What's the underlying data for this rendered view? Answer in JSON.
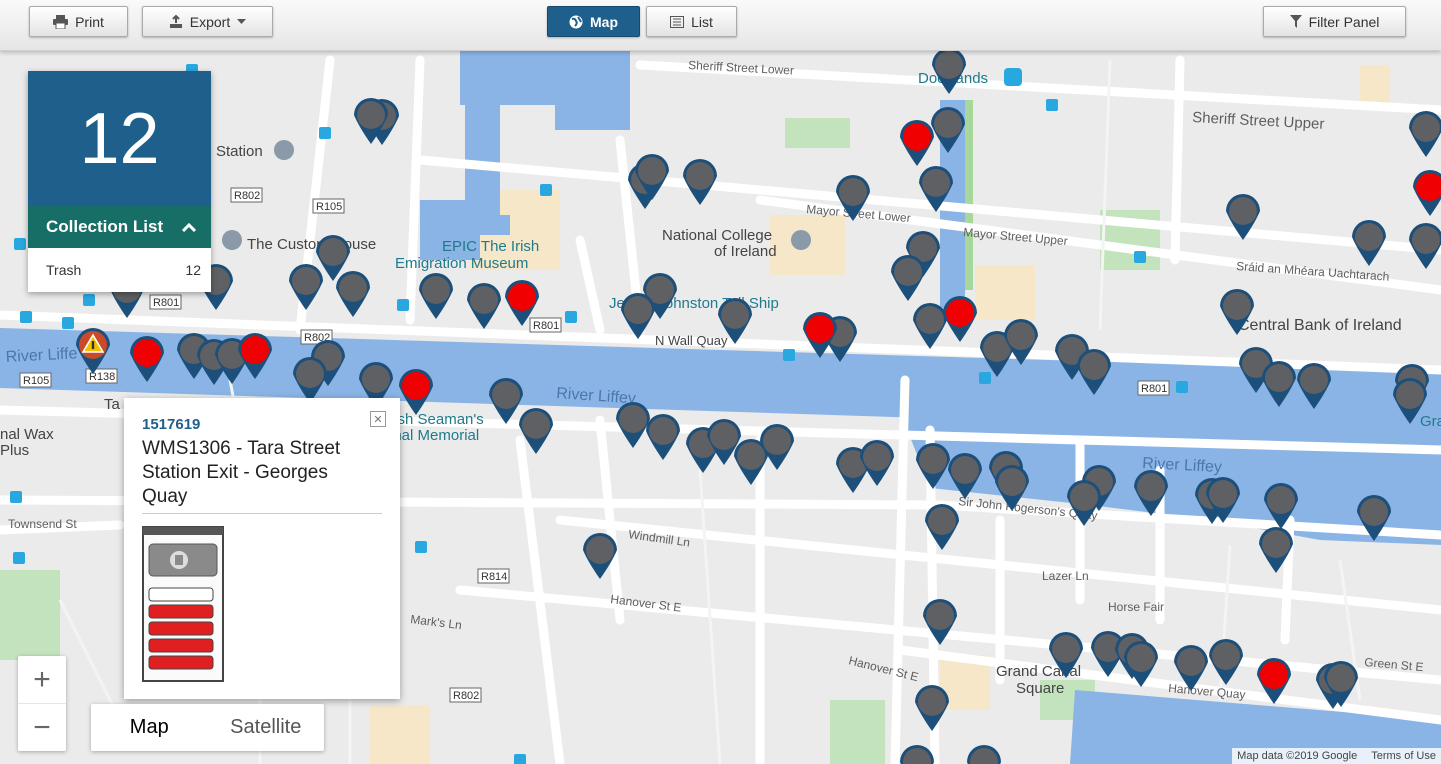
{
  "toolbar": {
    "print": "Print",
    "export": "Export",
    "map": "Map",
    "list": "List",
    "filter": "Filter Panel"
  },
  "counter": {
    "count": "12",
    "header": "Collection List",
    "items": [
      {
        "label": "Trash",
        "count": "12"
      }
    ]
  },
  "popup": {
    "id": "1517619",
    "name": "WMS1306 - Tara Street Station Exit - Georges Quay"
  },
  "map_type": {
    "map": "Map",
    "satellite": "Satellite"
  },
  "attribution": {
    "data": "Map data ©2019 Google",
    "terms": "Terms of Use"
  },
  "map_labels": {
    "sheriff_lower": "Sheriff Street Lower",
    "sheriff_upper": "Sheriff Street Upper",
    "docklands": "Docklands",
    "mayor_lower": "Mayor Street Lower",
    "mayor_upper": "Mayor Street Upper",
    "sraid": "Sráid an Mhéara Uachtarach",
    "ncoi_1": "National College",
    "ncoi_2": "of Ireland",
    "epic_1": "EPIC The Irish",
    "epic_2": "Emigration Museum",
    "jeanie": "Jeanie Johnston Tall Ship",
    "n_wall": "N Wall Quay",
    "liffey_1": "River Liffey",
    "liffey_2": "River Liffey",
    "liffey_left": "River Liffe",
    "central_bank": "Central Bank of Ireland",
    "seamans_1": "Irish Seaman's",
    "seamans_2": "onal Memorial",
    "custom_house": "The Custom House",
    "station": "Station",
    "wax_1": "nal Wax",
    "wax_2": "Plus",
    "townsend": "Townsend St",
    "windmill": "Windmill Ln",
    "hanover": "Hanover St E",
    "marks": "Mark's Ln",
    "lazer": "Lazer Ln",
    "horse": "Horse Fair",
    "grand_canal_1": "Grand Canal",
    "grand_canal_2": "Square",
    "hanover_quay": "Hanover Quay",
    "green_st": "Green St E",
    "john_rogerson": "Sir John Rogerson's Quay",
    "r802": "R802",
    "r105": "R105",
    "r801": "R801",
    "r814": "R814",
    "r138": "R138",
    "ta": "Ta",
    "gra": "Gra"
  },
  "colors": {
    "toolbar_active": "#1f5f8b",
    "counter_bg": "#1f5f8b",
    "list_header": "#176e67",
    "water": "#8ab4e6",
    "pin_grey": "#5f6063",
    "pin_red": "#f00000",
    "pin_ring": "#1c4f7a"
  }
}
